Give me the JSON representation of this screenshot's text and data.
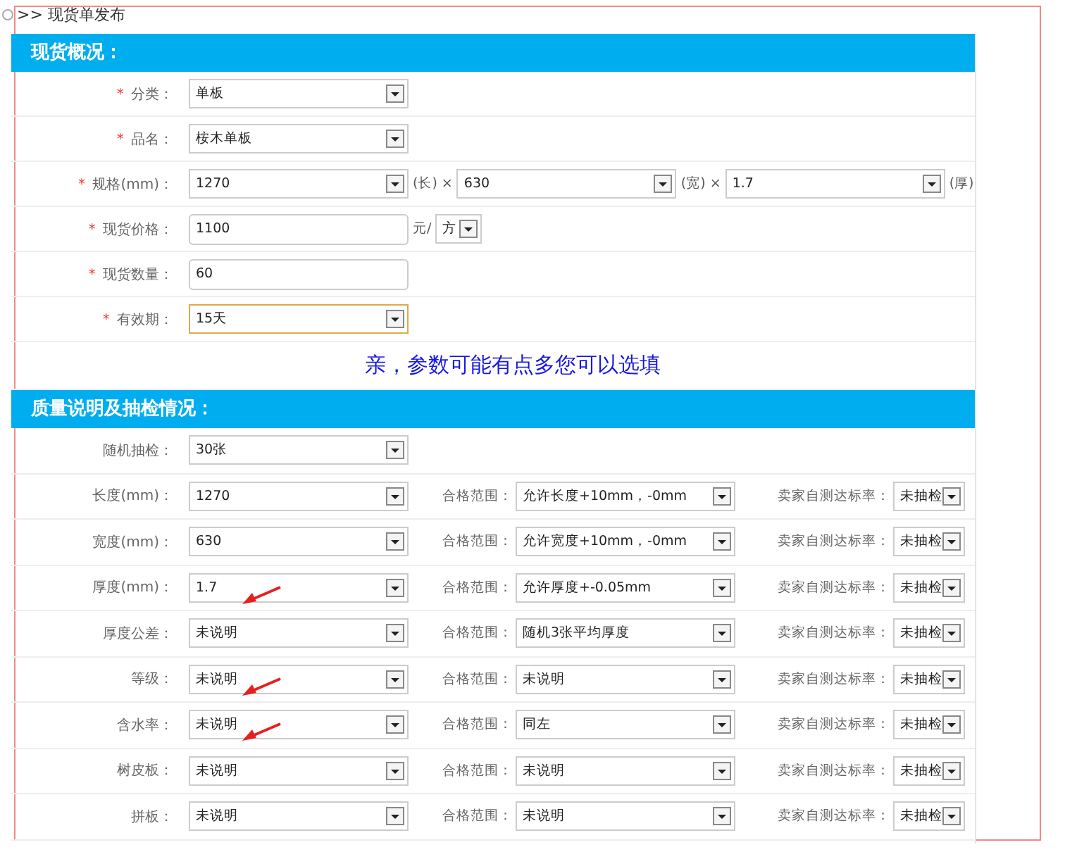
{
  "breadcrumb": ">> 现货单发布",
  "overview": {
    "title": "现货概况：",
    "rows": [
      {
        "mark": "*",
        "label": "分类：",
        "fields": [
          {
            "kind": "select",
            "value": "单板",
            "focused": false
          }
        ]
      },
      {
        "mark": "*",
        "label": "品名：",
        "fields": [
          {
            "kind": "select",
            "value": "桉木单板",
            "focused": false
          }
        ]
      },
      {
        "mark": "*",
        "label": "规格(mm)：",
        "fields": [
          {
            "kind": "select",
            "value": "1270",
            "focused": false,
            "suffix": "(长) ×"
          },
          {
            "kind": "select",
            "value": "630",
            "focused": false,
            "suffix": "(宽) ×"
          },
          {
            "kind": "select",
            "value": "1.7",
            "focused": false,
            "suffix": "(厚)"
          }
        ]
      },
      {
        "mark": "*",
        "label": "现货价格：",
        "fields": [
          {
            "kind": "input",
            "value": "1100",
            "suffix": "元/"
          },
          {
            "kind": "small-select",
            "value": "方",
            "focused": false
          }
        ]
      },
      {
        "mark": "*",
        "label": "现货数量：",
        "fields": [
          {
            "kind": "input",
            "value": "60"
          }
        ]
      },
      {
        "mark": "*",
        "label": "有效期：",
        "fields": [
          {
            "kind": "select",
            "value": "15天",
            "focused": true
          }
        ]
      }
    ]
  },
  "note": "亲，参数可能有点多您可以选填",
  "quality": {
    "title": "质量说明及抽检情况：",
    "rows": [
      {
        "label": "随机抽检：",
        "value": "30张",
        "arrow": false
      },
      {
        "label": "长度(mm)：",
        "value": "1270",
        "range_label": "合格范围：",
        "range": "允许长度+10mm，-0mm",
        "rate_label": "卖家自测达标率：",
        "rate": "未抽检",
        "arrow": false
      },
      {
        "label": "宽度(mm)：",
        "value": "630",
        "range_label": "合格范围：",
        "range": "允许宽度+10mm，-0mm",
        "rate_label": "卖家自测达标率：",
        "rate": "未抽检",
        "arrow": false
      },
      {
        "label": "厚度(mm)：",
        "value": "1.7",
        "range_label": "合格范围：",
        "range": "允许厚度+-0.05mm",
        "rate_label": "卖家自测达标率：",
        "rate": "未抽检",
        "arrow": true
      },
      {
        "label": "厚度公差：",
        "value": "未说明",
        "range_label": "合格范围：",
        "range": "随机3张平均厚度",
        "rate_label": "卖家自测达标率：",
        "rate": "未抽检",
        "arrow": false
      },
      {
        "label": "等级：",
        "value": "未说明",
        "range_label": "合格范围：",
        "range": "未说明",
        "rate_label": "卖家自测达标率：",
        "rate": "未抽检",
        "arrow": true
      },
      {
        "label": "含水率：",
        "value": "未说明",
        "range_label": "合格范围：",
        "range": "同左",
        "rate_label": "卖家自测达标率：",
        "rate": "未抽检",
        "arrow": true
      },
      {
        "label": "树皮板：",
        "value": "未说明",
        "range_label": "合格范围：",
        "range": "未说明",
        "rate_label": "卖家自测达标率：",
        "rate": "未抽检",
        "arrow": false
      },
      {
        "label": "拼板：",
        "value": "未说明",
        "range_label": "合格范围：",
        "range": "未说明",
        "rate_label": "卖家自测达标率：",
        "rate": "未抽检",
        "arrow": false
      }
    ]
  }
}
